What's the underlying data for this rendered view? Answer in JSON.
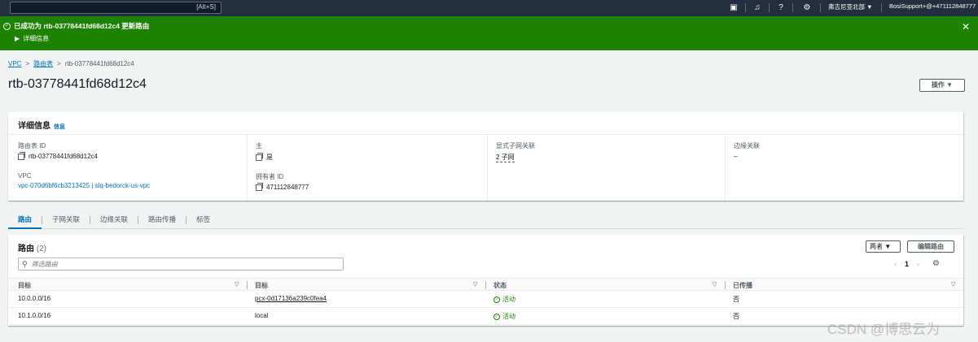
{
  "topnav": {
    "search_shortcut": "[Alt+S]",
    "region": "弗吉尼亚北部 ▼",
    "account": "BosiSupport+@+471112848777"
  },
  "flash": {
    "message": "已成功为 rtb-03778441fd68d12c4 更新路由",
    "detail_toggle": "详细信息"
  },
  "breadcrumb": {
    "items": [
      "VPC",
      "路由表",
      "rtb-03778441fd68d12c4"
    ]
  },
  "page": {
    "title": "rtb-03778441fd68d12c4",
    "actions_label": "操作 ▼"
  },
  "details": {
    "title": "详细信息",
    "info": "信息",
    "route_table_id_label": "路由表 ID",
    "route_table_id": "rtb-03778441fd68d12c4",
    "main_label": "主",
    "main_value": "是",
    "explicit_subnet_label": "显式子网关联",
    "explicit_subnet_value": "2 子网",
    "edge_assoc_label": "边缘关联",
    "edge_assoc_value": "–",
    "vpc_label": "VPC",
    "vpc_value": "vpc-070d6bf6cb3213425 | slq-bedorck-us-vpc",
    "owner_label": "拥有者 ID",
    "owner_value": "471112848777"
  },
  "tabs": [
    "路由",
    "子网关联",
    "边缘关联",
    "路由传播",
    "标签"
  ],
  "routes": {
    "title": "路由",
    "count": "(2)",
    "filter_placeholder": "筛选路由",
    "select_label": "两者 ▼",
    "edit_label": "编辑路由",
    "page_number": "1",
    "columns": [
      "目标",
      "目标",
      "状态",
      "已传播"
    ],
    "rows": [
      {
        "destination": "10.0.0.0/16",
        "target": "pcx-0d17136a239c0fea4",
        "target_is_link": true,
        "status": "活动",
        "propagated": "否"
      },
      {
        "destination": "10.1.0.0/16",
        "target": "local",
        "target_is_link": false,
        "status": "活动",
        "propagated": "否"
      }
    ]
  },
  "watermark": "CSDN @博思云为",
  "colors": {
    "nav_bg": "#232f3e",
    "success_green": "#1d8102",
    "link_blue": "#0073bb"
  }
}
